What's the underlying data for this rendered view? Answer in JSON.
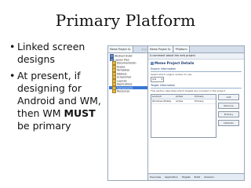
{
  "slide": {
    "title": "Primary Platform",
    "bullets": [
      {
        "text": "Linked screen designs"
      },
      {
        "pre": "At present, if designing for Android and WM, then WM ",
        "bold": "MUST",
        "post": " be primary"
      }
    ]
  },
  "ide": {
    "left_tabs": [
      "Meme Project Sc"
    ],
    "left_controls": "▽ ▢",
    "tree": [
      {
        "label": "Abstract Build",
        "icon": "project-icon",
        "indent": 0
      },
      {
        "label": "Lesson Plan",
        "icon": "project-icon",
        "indent": 0
      },
      {
        "label": "Documentation",
        "icon": "folder-icon",
        "indent": 1
      },
      {
        "label": "Assets",
        "icon": "folder-icon",
        "indent": 1
      },
      {
        "label": "Templates",
        "icon": "folder-icon",
        "indent": 1
      },
      {
        "label": "Address",
        "icon": "folder-icon",
        "indent": 1
      },
      {
        "label": "Screenshot",
        "icon": "folder-icon",
        "indent": 1
      },
      {
        "label": "Layouts",
        "icon": "folder-icon",
        "indent": 1
      },
      {
        "label": "Applications",
        "icon": "folder-icon",
        "indent": 1
      },
      {
        "label": "Components",
        "icon": "folder-icon",
        "indent": 1,
        "selected": true
      },
      {
        "label": "Resources",
        "icon": "folder-icon",
        "indent": 1
      }
    ],
    "editor_tabs": [
      "Meme Project Sc",
      "*Platform"
    ],
    "editor": {
      "header": "A comment about the new project",
      "title": "Meme Project Details",
      "engine_section": "Engine Information",
      "engine_desc": "Select which engine version to use",
      "engine_value": "4.8",
      "targets_section": "Target Information",
      "targets_desc": "This section describes which targets are included in the project",
      "columns": [
        "Android",
        "Active",
        "Primary"
      ],
      "rows": [
        [
          "Windows Mobile",
          "Active",
          "Primary"
        ]
      ],
      "buttons": [
        "Add",
        "Remove",
        "Primary",
        "Defaults"
      ]
    },
    "bottom_tabs": [
      "Overview",
      "Application",
      "Targets",
      "Build",
      "Versions"
    ]
  }
}
